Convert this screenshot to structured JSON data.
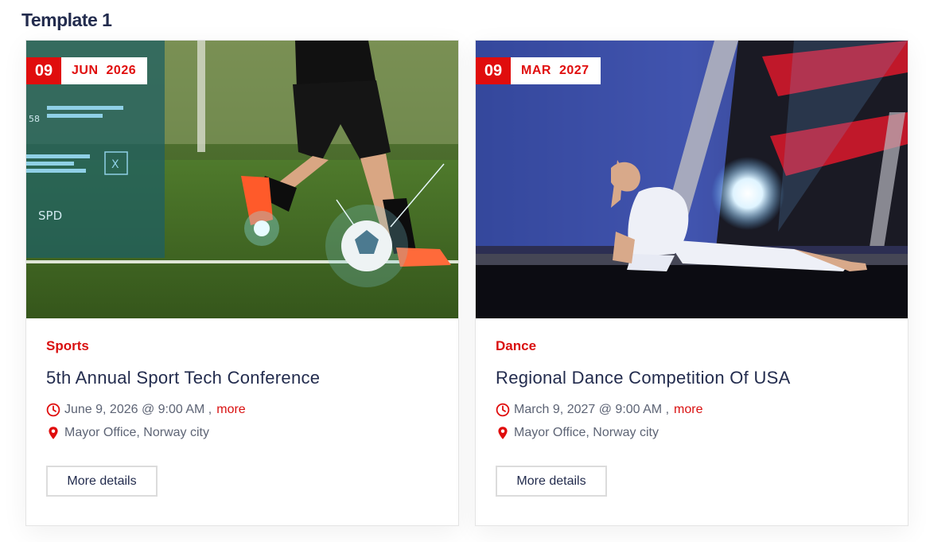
{
  "heading": "Template 1",
  "colors": {
    "accent": "#e00d0d",
    "title": "#232c4e",
    "meta": "#5d6475"
  },
  "events": [
    {
      "day": "09",
      "month": "JUN",
      "year": "2026",
      "category": "Sports",
      "title": "5th Annual Sport Tech Conference",
      "datetime": "June 9, 2026 @ 9:00 AM ,",
      "more_label": "more",
      "location": "Mayor Office, Norway city",
      "button_label": "More details",
      "image": "soccer-player-photo"
    },
    {
      "day": "09",
      "month": "MAR",
      "year": "2027",
      "category": "Dance",
      "title": "Regional Dance Competition Of USA",
      "datetime": "March 9, 2027 @ 9:00 AM ,",
      "more_label": "more",
      "location": "Mayor Office, Norway city",
      "button_label": "More details",
      "image": "dancer-stage-photo"
    }
  ]
}
